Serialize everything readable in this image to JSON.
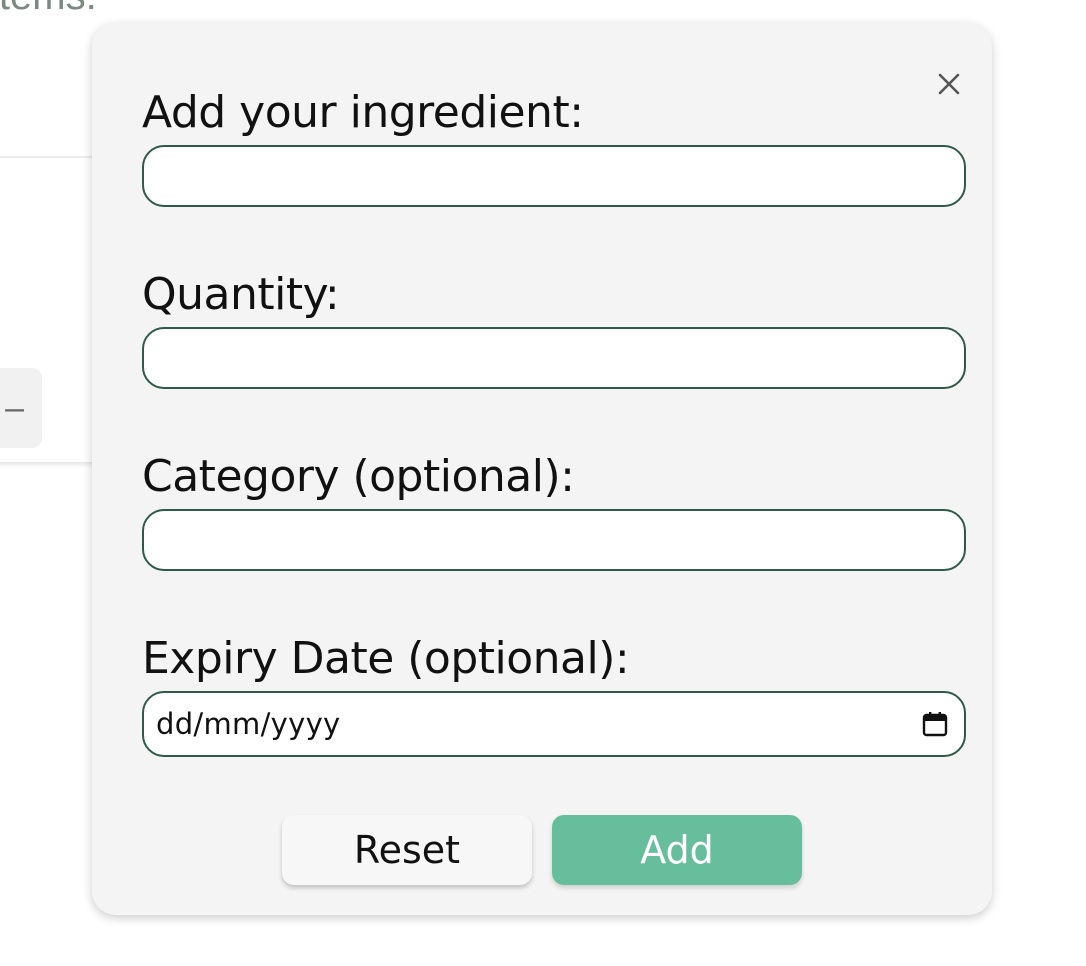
{
  "background": {
    "heading_fragment": "items:",
    "minus_button_label": "–"
  },
  "modal": {
    "close_label": "×",
    "fields": [
      {
        "label": "Add your ingredient:",
        "value": "",
        "placeholder": ""
      },
      {
        "label": "Quantity:",
        "value": "",
        "placeholder": ""
      },
      {
        "label": "Category (optional):",
        "value": "",
        "placeholder": ""
      },
      {
        "label": "Expiry Date (optional):",
        "value": "dd/mm/yyyy"
      }
    ],
    "buttons": {
      "reset_label": "Reset",
      "add_label": "Add"
    },
    "icons": {
      "close": "close-icon",
      "date": "calendar-icon"
    }
  },
  "colors": {
    "modal_background": "#f4f4f4",
    "input_border": "#2f5a48",
    "add_button": "#67be9c",
    "reset_button": "#f7f7f7",
    "background_heading": "#7a8a80"
  }
}
